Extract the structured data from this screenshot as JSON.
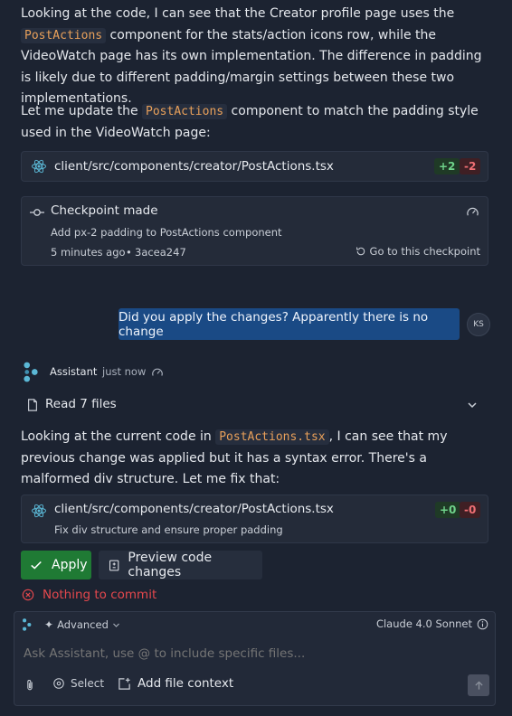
{
  "para1": {
    "before": "Looking at the code, I can see that the Creator profile page uses the ",
    "code": "PostActions",
    "after": " component for the stats/action icons row, while the VideoWatch page has its own implementation. The difference in padding is likely due to different padding/margin settings between these two implementations."
  },
  "para2": {
    "before": "Let me update the ",
    "code": "PostActions",
    "after": " component to match the padding style used in the VideoWatch page:"
  },
  "file_card_1": {
    "path": "client/src/components/creator/PostActions.tsx",
    "added": "+2",
    "removed": "-2"
  },
  "checkpoint": {
    "title": "Checkpoint made",
    "description": "Add px-2 padding to PostActions component",
    "time": "5 minutes ago",
    "hash": "3acea247",
    "goto_label": "Go to this checkpoint"
  },
  "user_message": {
    "text": "Did you apply the changes? Apparently there is no change",
    "initials": "KS"
  },
  "assistant_header": {
    "name": "Assistant",
    "time": "just now"
  },
  "read_files": {
    "label": "Read 7 files"
  },
  "para3": {
    "before": "Looking at the current code in ",
    "code": "PostActions.tsx",
    "after": ", I can see that my previous change was applied but it has a syntax error. There's a malformed div structure. Let me fix that:"
  },
  "file_card_2": {
    "path": "client/src/components/creator/PostActions.tsx",
    "description": "Fix div structure and ensure proper padding",
    "added": "+0",
    "removed": "-0"
  },
  "actions": {
    "apply_label": "Apply",
    "preview_label": "Preview code changes"
  },
  "error": {
    "text": "Nothing to commit"
  },
  "composer": {
    "mode_label": "Advanced",
    "model_label": "Claude 4.0 Sonnet",
    "placeholder": "Ask Assistant, use @ to include specific files...",
    "select_label": "Select",
    "add_context_label": "Add file context"
  },
  "colors": {
    "background": "#1c2331",
    "user_bubble": "#1a4a85",
    "apply_green": "#1f7a34",
    "error_red": "#e5484d",
    "code_orange": "#e8a05a",
    "react_cyan": "#5bb8d6"
  }
}
